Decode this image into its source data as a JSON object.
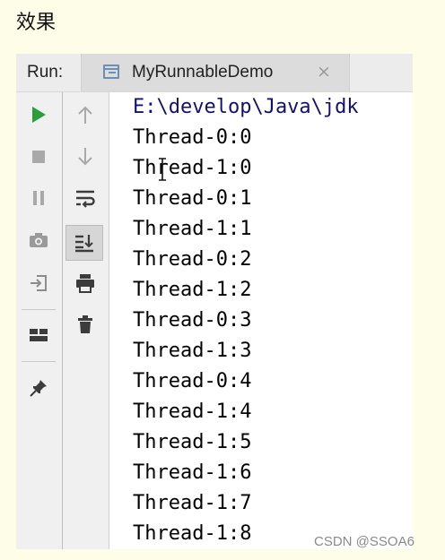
{
  "heading": "效果",
  "run_panel": {
    "run_label": "Run:",
    "tab": {
      "title": "MyRunnableDemo",
      "close_glyph": "×"
    },
    "left_toolbar": [
      "play-icon",
      "stop-icon",
      "pause-icon",
      "camera-icon",
      "login-icon",
      "layout-icon",
      "pin-icon"
    ],
    "mid_toolbar": [
      "arrow-up-icon",
      "arrow-down-icon",
      "soft-wrap-icon",
      "scroll-to-end-icon",
      "print-icon",
      "trash-icon"
    ],
    "colors": {
      "play": "#2e9b3d",
      "icon_gray": "#8c8c8c",
      "icon_dark": "#3c3c3c",
      "path_text": "#12126e"
    }
  },
  "console": {
    "lines": [
      "E:\\develop\\Java\\jdk",
      "Thread-0:0",
      "Thread-1:0",
      "Thread-0:1",
      "Thread-1:1",
      "Thread-0:2",
      "Thread-1:2",
      "Thread-0:3",
      "Thread-1:3",
      "Thread-0:4",
      "Thread-1:4",
      "Thread-1:5",
      "Thread-1:6",
      "Thread-1:7",
      "Thread-1:8"
    ]
  },
  "watermark": "CSDN @SSOA6"
}
